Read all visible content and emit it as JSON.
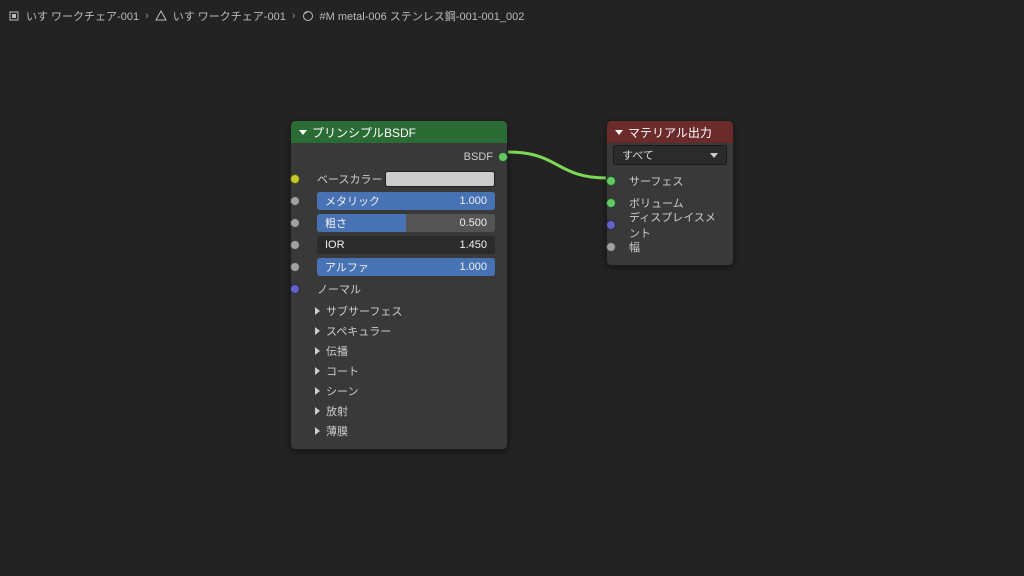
{
  "breadcrumb": {
    "obj": "いす ワークチェア-001",
    "material_slot": "いす ワークチェア-001",
    "material": "#M metal-006 ステンレス鋼-001-001_002"
  },
  "bsdf": {
    "title": "プリンシプルBSDF",
    "output_bsdf": "BSDF",
    "base_color_label": "ベースカラー",
    "metallic": {
      "label": "メタリック",
      "value": "1.000",
      "fill_pct": 100
    },
    "roughness": {
      "label": "粗さ",
      "value": "0.500",
      "fill_pct": 50
    },
    "ior": {
      "label": "IOR",
      "value": "1.450",
      "fill_pct": 0
    },
    "alpha": {
      "label": "アルファ",
      "value": "1.000",
      "fill_pct": 100
    },
    "normal_label": "ノーマル",
    "groups": [
      "サブサーフェス",
      "スペキュラー",
      "伝播",
      "コート",
      "シーン",
      "放射",
      "薄膜"
    ]
  },
  "output": {
    "title": "マテリアル出力",
    "target": "すべて",
    "surface": "サーフェス",
    "volume": "ボリューム",
    "displacement": "ディスプレイスメント",
    "thickness": "幅"
  },
  "colors": {
    "link": "#7ed957"
  }
}
